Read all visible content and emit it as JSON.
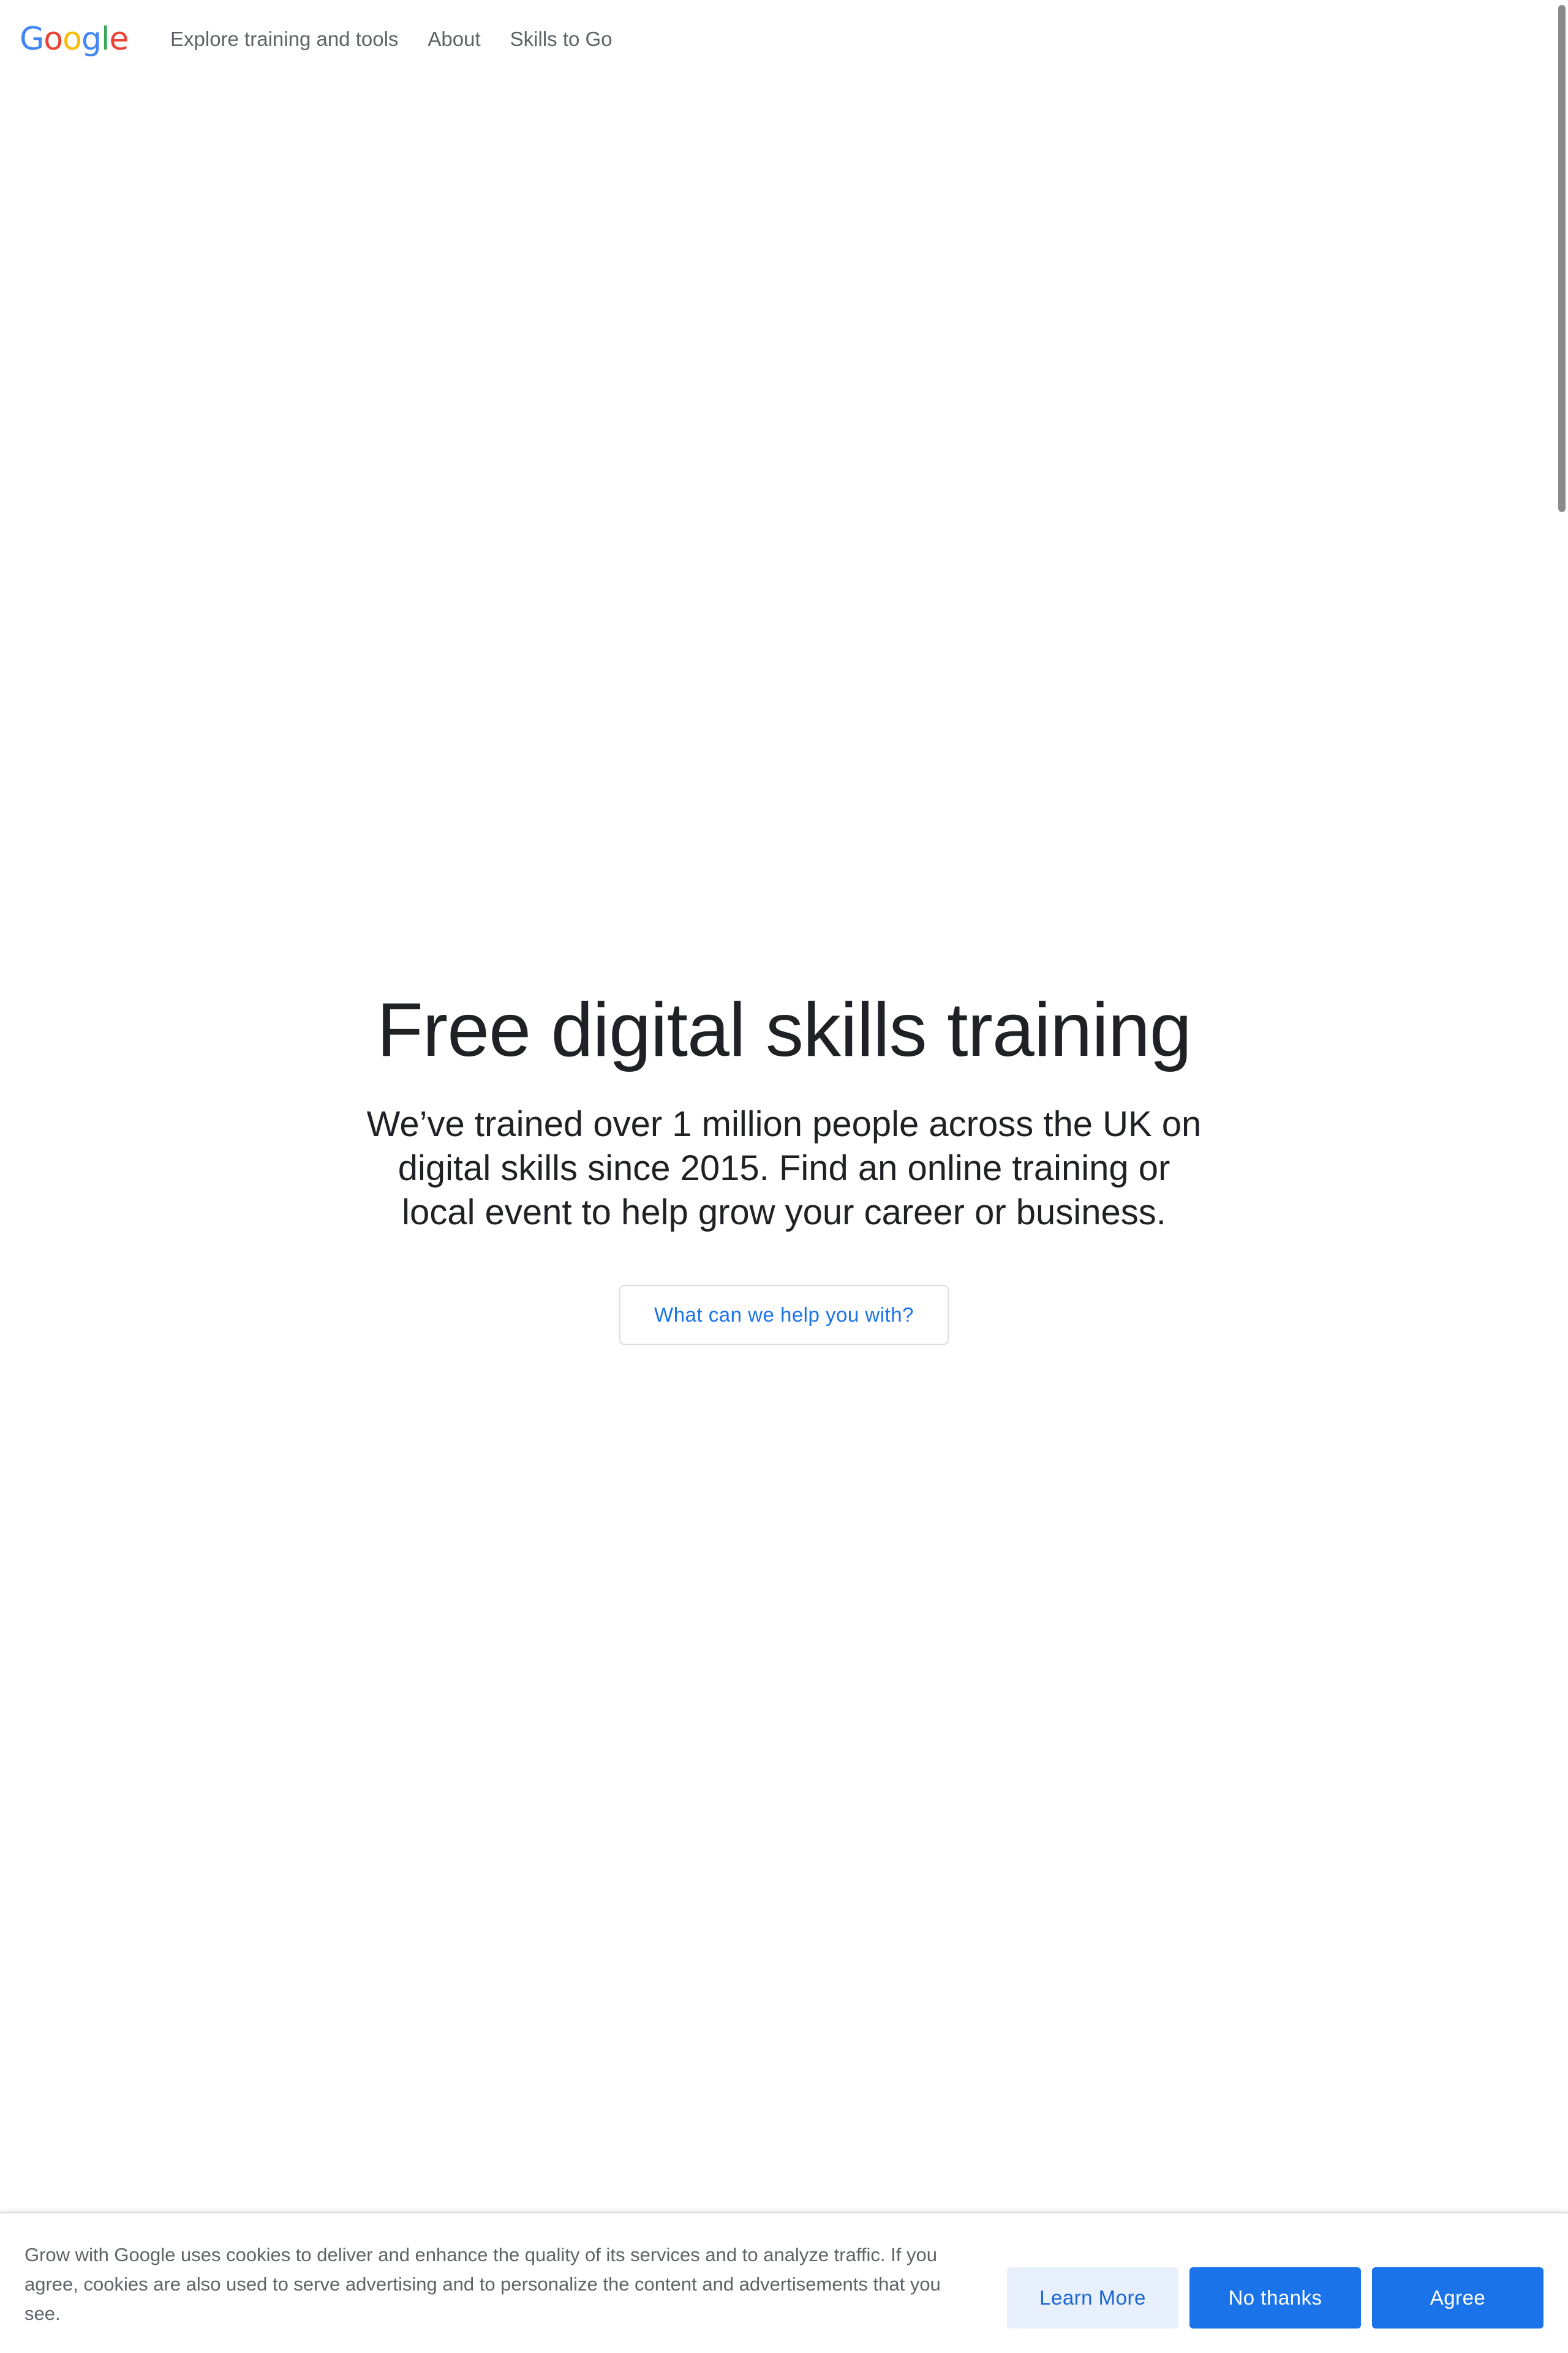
{
  "header": {
    "logo": {
      "letters": [
        "G",
        "o",
        "o",
        "g",
        "l",
        "e"
      ],
      "colors": [
        "#4285f4",
        "#ea4335",
        "#fbbc05",
        "#4285f4",
        "#34a853",
        "#ea4335"
      ]
    },
    "nav": [
      {
        "label": "Explore training and tools"
      },
      {
        "label": "About"
      },
      {
        "label": "Skills to Go"
      }
    ]
  },
  "hero": {
    "title": "Free digital skills training",
    "subtitle": "We’ve trained over 1 million people across the UK on digital skills since 2015. Find an online training or local event to help grow your career or business.",
    "cta_label": "What can we help you with?"
  },
  "cookie_banner": {
    "text": "Grow with Google uses cookies to deliver and enhance the quality of its services and to analyze traffic. If you agree, cookies are also used to serve advertising and to personalize the content and advertisements that you see.",
    "learn_more_label": "Learn More",
    "no_thanks_label": "No thanks",
    "agree_label": "Agree"
  },
  "colors": {
    "accent": "#1a73e8",
    "text_primary": "#202124",
    "text_secondary": "#5f6368"
  }
}
